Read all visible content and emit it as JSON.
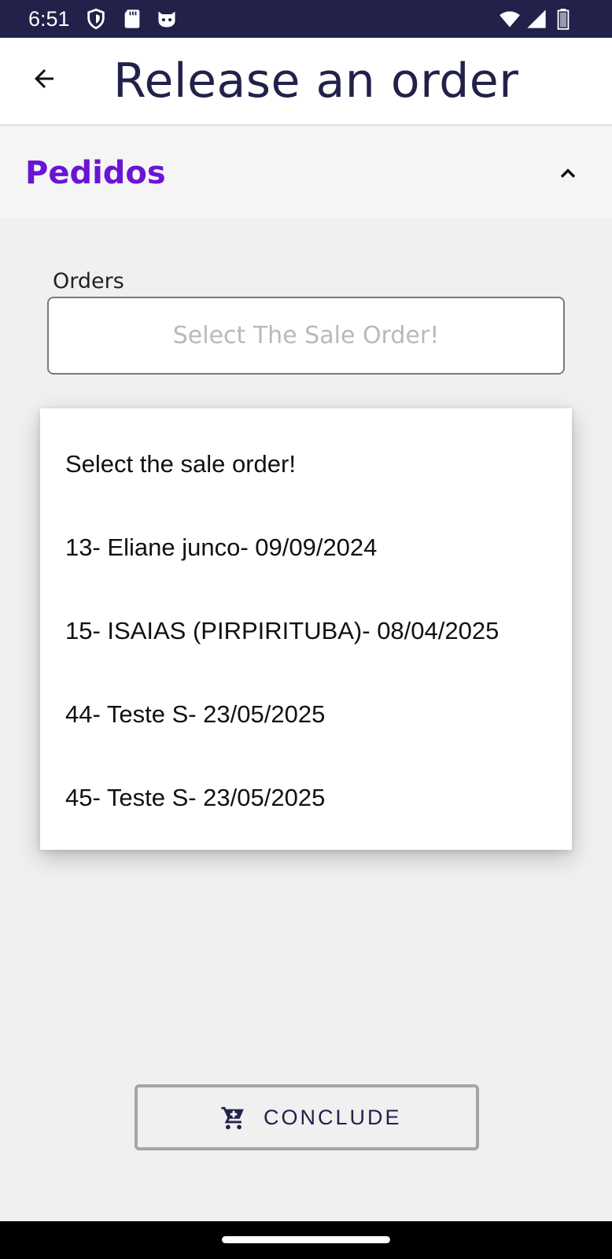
{
  "status_bar": {
    "time": "6:51",
    "left_icons": [
      "shield-icon",
      "sd-card-icon",
      "cat-face-icon"
    ],
    "right_icons": [
      "wifi-icon",
      "cell-signal-icon",
      "battery-icon"
    ]
  },
  "app_bar": {
    "back_icon": "arrow-back-icon",
    "title": "Release an order"
  },
  "accordion": {
    "title": "Pedidos",
    "chevron_icon": "chevron-up-icon",
    "title_color": "#6a14d6"
  },
  "orders_field": {
    "label": "Orders",
    "placeholder": "Select The Sale Order!"
  },
  "dropdown": {
    "options": [
      "Select the sale order!",
      "13- Eliane junco- 09/09/2024",
      "15- ISAIAS (PIRPIRITUBA)- 08/04/2025",
      "44- Teste S- 23/05/2025",
      "45- Teste S- 23/05/2025"
    ]
  },
  "conclude_button": {
    "icon": "cart-icon",
    "label": "CONCLUDE"
  },
  "colors": {
    "status_bar": "#22214a",
    "title_text": "#22214a",
    "accent": "#6a14d6",
    "background": "#f0f0f0"
  }
}
